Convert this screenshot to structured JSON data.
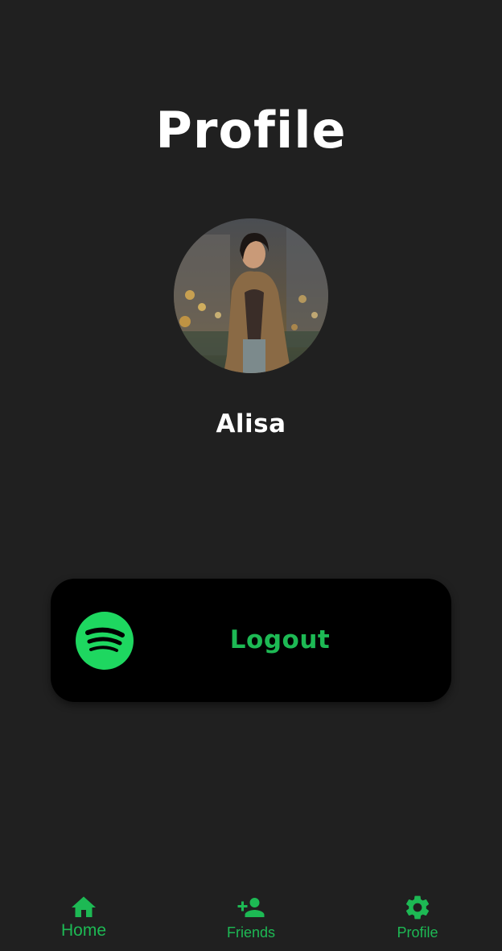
{
  "header": {
    "title": "Profile"
  },
  "profile": {
    "name": "Alisa"
  },
  "logout": {
    "label": "Logout",
    "icon": "spotify-logo-icon"
  },
  "bottom_nav": {
    "items": [
      {
        "label": "Home",
        "icon": "home-icon"
      },
      {
        "label": "Friends",
        "icon": "add-person-icon"
      },
      {
        "label": "Profile",
        "icon": "gear-icon"
      }
    ]
  },
  "colors": {
    "background": "#202020",
    "accent": "#1ED760",
    "nav_accent": "#1DB954",
    "card": "#000000",
    "text": "#FFFFFF"
  }
}
